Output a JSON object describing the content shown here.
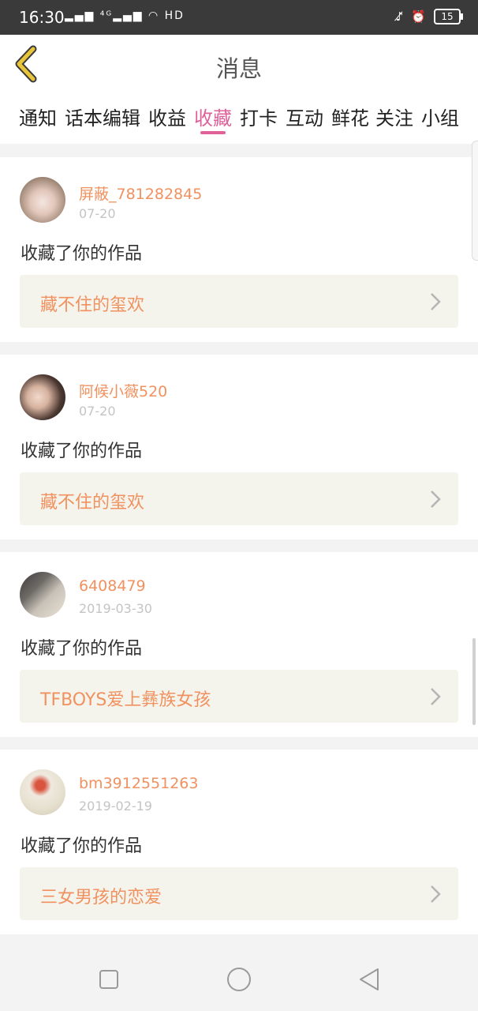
{
  "status_bar": {
    "time": "16:30",
    "signal": "ᵡ᠁ ⁴ᴳ᠁",
    "battery_level": "15",
    "icons": [
      "mute-vibrate-icon",
      "alarm-icon",
      "battery-icon"
    ]
  },
  "header": {
    "title": "消息",
    "back_icon": "back-chevron-icon"
  },
  "tabs": [
    {
      "label": "通知"
    },
    {
      "label": "话本编辑"
    },
    {
      "label": "收益"
    },
    {
      "label": "收藏"
    },
    {
      "label": "打卡"
    },
    {
      "label": "互动"
    },
    {
      "label": "鲜花"
    },
    {
      "label": "关注"
    },
    {
      "label": "小组"
    }
  ],
  "active_tab": "收藏",
  "messages": [
    {
      "username": "屏蔽_781282845",
      "date": "07-20",
      "action": "收藏了你的作品",
      "work_title": "藏不住的玺欢"
    },
    {
      "username": "阿候小薇520",
      "date": "07-20",
      "action": "收藏了你的作品",
      "work_title": "藏不住的玺欢"
    },
    {
      "username": "6408479",
      "date": "2019-03-30",
      "action": "收藏了你的作品",
      "work_title": "TFBOYS爱上彝族女孩"
    },
    {
      "username": "bm3912551263",
      "date": "2019-02-19",
      "action": "收藏了你的作品",
      "work_title": "三女男孩的恋爱"
    }
  ],
  "colors": {
    "accent_pink": "#e0619a",
    "username_orange": "#f0915f",
    "back_yellow": "#e8c43a",
    "link_bg": "#f5f4ec"
  },
  "nav": [
    "recent-apps-icon",
    "home-icon",
    "back-triangle-icon"
  ]
}
